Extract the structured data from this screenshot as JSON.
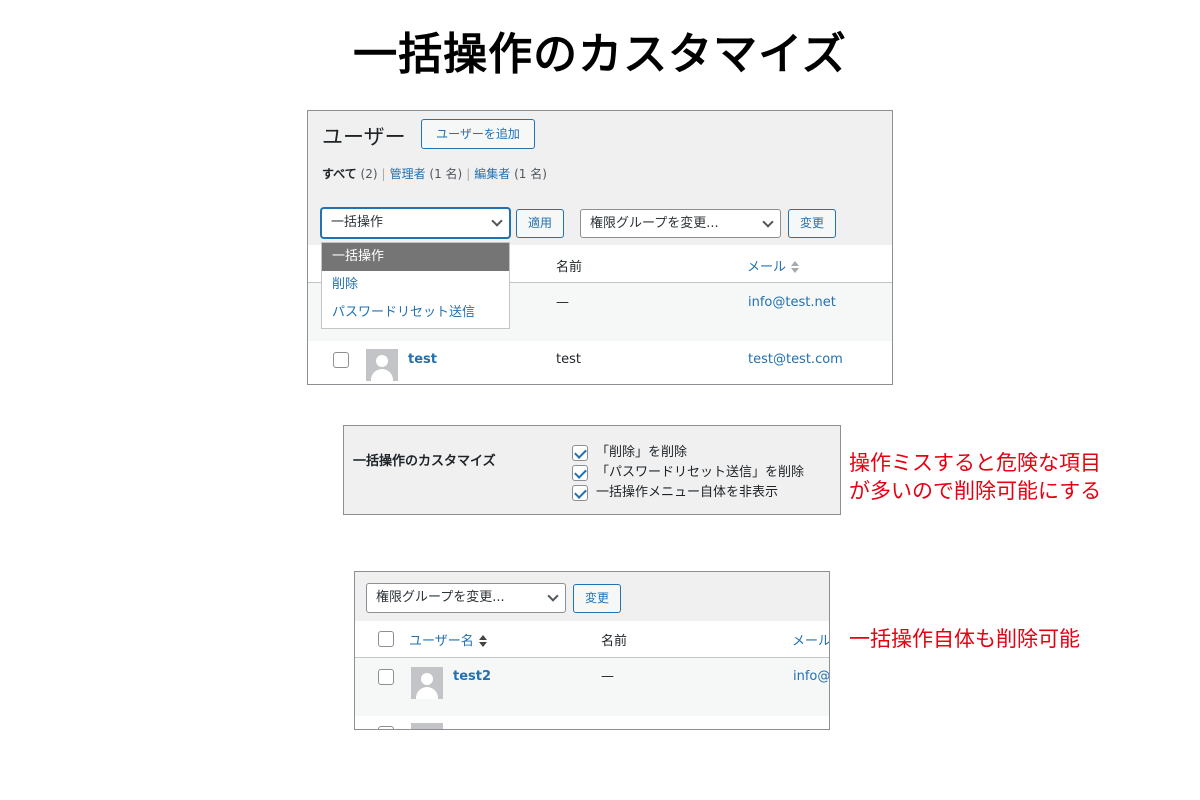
{
  "title": "一括操作のカスタマイズ",
  "panel1": {
    "heading": "ユーザー",
    "add_button": "ユーザーを追加",
    "views": {
      "all": "すべて",
      "all_count": "(2)",
      "admin": "管理者",
      "admin_count": "(1 名)",
      "editor": "編集者",
      "editor_count": "(1 名)",
      "separator": "|"
    },
    "bulk_select": "一括操作",
    "apply_button": "適用",
    "role_select": "権限グループを変更...",
    "change_button": "変更",
    "dropdown_options": [
      "一括操作",
      "削除",
      "パスワードリセット送信"
    ],
    "columns": {
      "name": "名前",
      "email": "メール"
    },
    "rows": [
      {
        "username": "",
        "name": "—",
        "email": "info@test.net"
      },
      {
        "username": "test",
        "name": "test",
        "email": "test@test.com"
      }
    ]
  },
  "panel2": {
    "label": "一括操作のカスタマイズ",
    "options": [
      {
        "label": "「削除」を削除",
        "checked": true
      },
      {
        "label": "「パスワードリセット送信」を削除",
        "checked": true
      },
      {
        "label": "一括操作メニュー自体を非表示",
        "checked": true
      }
    ]
  },
  "note1": {
    "line1": "操作ミスすると危険な項目",
    "line2": "が多いので削除可能にする"
  },
  "panel3": {
    "role_select": "権限グループを変更...",
    "change_button": "変更",
    "columns": {
      "username": "ユーザー名",
      "name": "名前",
      "email": "メール"
    },
    "rows": [
      {
        "username": "test2",
        "name": "—",
        "email": "info@"
      }
    ]
  },
  "note2": "一括操作自体も削除可能",
  "colors": {
    "link": "#2271b1",
    "annotation": "#e60012",
    "panel_bg": "#f0f0f1"
  }
}
